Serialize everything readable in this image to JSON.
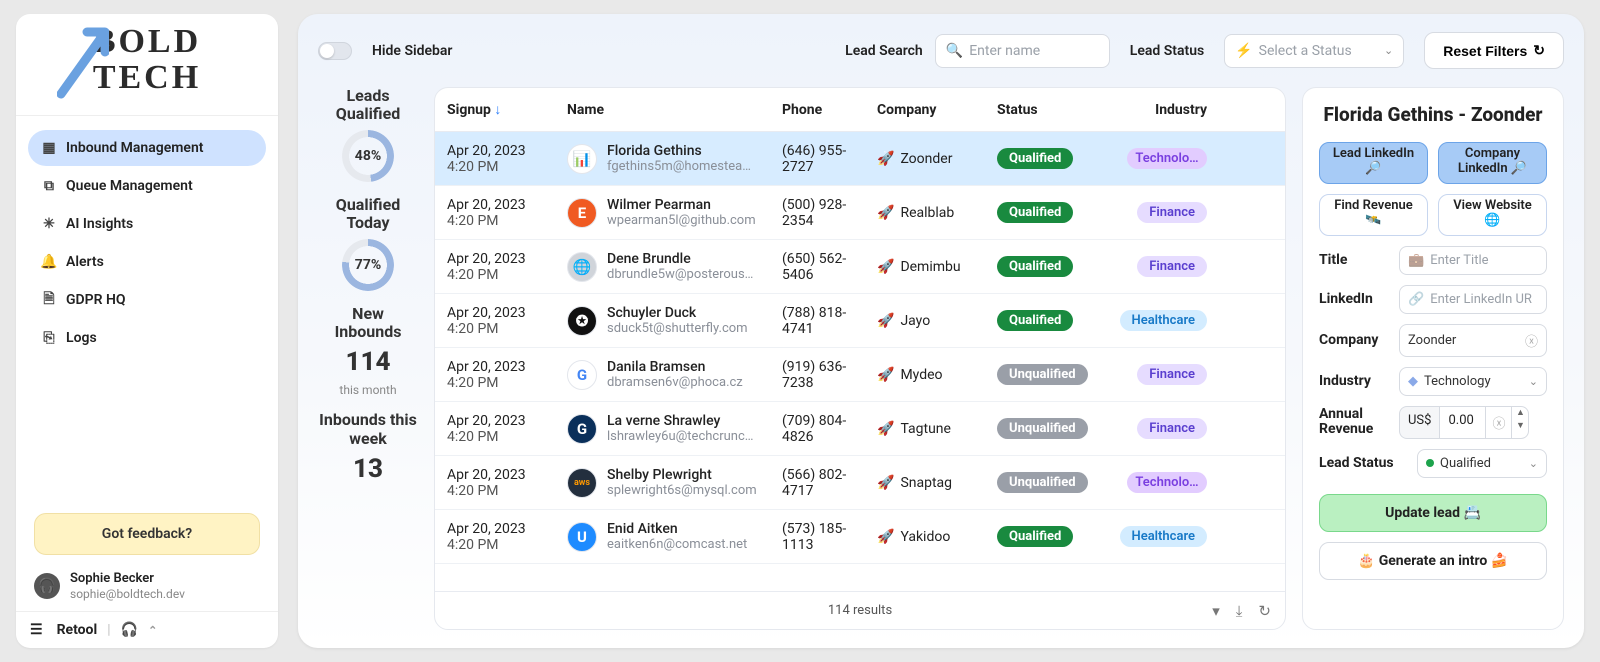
{
  "brand": "BOLD\nTECH",
  "sidebar": {
    "items": [
      {
        "label": "Inbound Management",
        "active": true
      },
      {
        "label": "Queue Management",
        "active": false
      },
      {
        "label": "AI Insights",
        "active": false
      },
      {
        "label": "Alerts",
        "active": false
      },
      {
        "label": "GDPR HQ",
        "active": false
      },
      {
        "label": "Logs",
        "active": false
      }
    ],
    "feedback": "Got feedback?",
    "user": {
      "name": "Sophie Becker",
      "email": "sophie@boldtech.dev"
    },
    "footer_brand": "Retool"
  },
  "toolbar": {
    "hide_sidebar": "Hide Sidebar",
    "lead_search_label": "Lead Search",
    "lead_search_placeholder": "Enter name",
    "lead_status_label": "Lead Status",
    "status_placeholder": "Select a Status",
    "reset": "Reset Filters"
  },
  "metrics": {
    "leads_qualified_label": "Leads Qualified",
    "leads_qualified_pct": "48%",
    "qualified_today_label": "Qualified Today",
    "qualified_today_pct": "77%",
    "new_inbounds_label": "New Inbounds",
    "new_inbounds_value": "114",
    "new_inbounds_sub": "this month",
    "inbounds_week_label": "Inbounds this week",
    "inbounds_week_value": "13"
  },
  "table": {
    "columns": {
      "signup": "Signup",
      "name": "Name",
      "phone": "Phone",
      "company": "Company",
      "status": "Status",
      "industry": "Industry"
    },
    "results_label": "114 results",
    "rows": [
      {
        "date": "Apr 20, 2023",
        "time": "4:20 PM",
        "name": "Florida Gethins",
        "email": "fgethins5m@homestea…",
        "phone": "(646) 955-2727",
        "company": "Zoonder",
        "status": "Qualified",
        "industry": "Technolo…",
        "av_bg": "#fff",
        "av_fg": "#f0a020",
        "av_txt": "📊",
        "selected": true
      },
      {
        "date": "Apr 20, 2023",
        "time": "4:20 PM",
        "name": "Wilmer Pearman",
        "email": "wpearman5l@github.com",
        "phone": "(500) 928-2354",
        "company": "Realblab",
        "status": "Qualified",
        "industry": "Finance",
        "av_bg": "#f05a22",
        "av_fg": "#fff",
        "av_txt": "E"
      },
      {
        "date": "Apr 20, 2023",
        "time": "4:20 PM",
        "name": "Dene Brundle",
        "email": "dbrundle5w@posterous…",
        "phone": "(650) 562-5406",
        "company": "Demimbu",
        "status": "Qualified",
        "industry": "Finance",
        "av_bg": "#d0d4da",
        "av_fg": "#555",
        "av_txt": "🌐"
      },
      {
        "date": "Apr 20, 2023",
        "time": "4:20 PM",
        "name": "Schuyler Duck",
        "email": "sduck5t@shutterfly.com",
        "phone": "(788) 818-4741",
        "company": "Jayo",
        "status": "Qualified",
        "industry": "Healthcare",
        "av_bg": "#111",
        "av_fg": "#fff",
        "av_txt": "✪"
      },
      {
        "date": "Apr 20, 2023",
        "time": "4:20 PM",
        "name": "Danila Bramsen",
        "email": "dbramsen6v@phoca.cz",
        "phone": "(919) 636-7238",
        "company": "Mydeo",
        "status": "Unqualified",
        "industry": "Finance",
        "av_bg": "#fff",
        "av_fg": "#4285f4",
        "av_txt": "G"
      },
      {
        "date": "Apr 20, 2023",
        "time": "4:20 PM",
        "name": "La verne Shrawley",
        "email": "lshrawley6u@techcrunc…",
        "phone": "(709) 804-4826",
        "company": "Tagtune",
        "status": "Unqualified",
        "industry": "Finance",
        "av_bg": "#0a2f5a",
        "av_fg": "#fff",
        "av_txt": "G"
      },
      {
        "date": "Apr 20, 2023",
        "time": "4:20 PM",
        "name": "Shelby Plewright",
        "email": "splewright6s@mysql.com",
        "phone": "(566) 802-4717",
        "company": "Snaptag",
        "status": "Unqualified",
        "industry": "Technolo…",
        "av_bg": "#232f3e",
        "av_fg": "#ff9900",
        "av_txt": "aws"
      },
      {
        "date": "Apr 20, 2023",
        "time": "4:20 PM",
        "name": "Enid Aitken",
        "email": "eaitken6n@comcast.net",
        "phone": "(573) 185-1113",
        "company": "Yakidoo",
        "status": "Qualified",
        "industry": "Healthcare",
        "av_bg": "#1e8bff",
        "av_fg": "#fff",
        "av_txt": "U"
      }
    ]
  },
  "details": {
    "title": "Florida Gethins - Zoonder",
    "buttons": {
      "lead_linkedin": "Lead LinkedIn 🔎",
      "company_linkedin": "Company LinkedIn 🔎",
      "find_revenue": "Find Revenue 🛰️",
      "view_website": "View Website 🌐"
    },
    "fields": {
      "title_label": "Title",
      "title_placeholder": "Enter Title",
      "linkedin_label": "LinkedIn",
      "linkedin_placeholder": "Enter LinkedIn UR",
      "company_label": "Company",
      "company_value": "Zoonder",
      "industry_label": "Industry",
      "industry_value": "Technology",
      "revenue_label": "Annual Revenue",
      "revenue_currency": "US$",
      "revenue_value": "0.00",
      "status_label": "Lead Status",
      "status_value": "Qualified"
    },
    "update_btn": "Update lead 📇",
    "intro_btn": "🎂 Generate an intro 🍰"
  }
}
